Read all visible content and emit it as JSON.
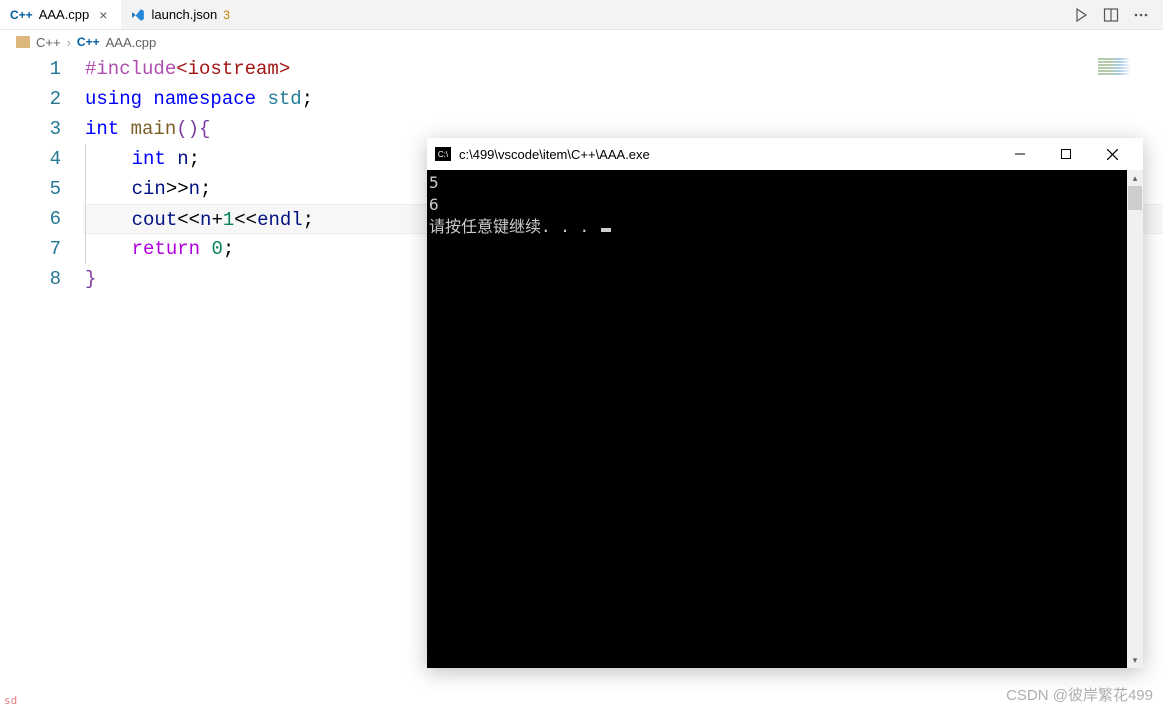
{
  "tabs": {
    "items": [
      {
        "label": "AAA.cpp",
        "icon": "C++",
        "active": true,
        "closable": true
      },
      {
        "label": "launch.json",
        "icon": "vs",
        "badge": "3",
        "active": false
      }
    ]
  },
  "breadcrumb": {
    "folder": "C++",
    "file": "AAA.cpp"
  },
  "code": {
    "lines": [
      {
        "n": "1",
        "tokens": [
          {
            "c": "tk-preproc",
            "t": "#include"
          },
          {
            "c": "tk-string",
            "t": "<iostream>"
          }
        ]
      },
      {
        "n": "2",
        "tokens": [
          {
            "c": "tk-keyword",
            "t": "using"
          },
          {
            "c": "tk-plain",
            "t": " "
          },
          {
            "c": "tk-keyword",
            "t": "namespace"
          },
          {
            "c": "tk-plain",
            "t": " "
          },
          {
            "c": "tk-namespace",
            "t": "std"
          },
          {
            "c": "tk-plain",
            "t": ";"
          }
        ]
      },
      {
        "n": "3",
        "tokens": [
          {
            "c": "tk-keyword",
            "t": "int"
          },
          {
            "c": "tk-plain",
            "t": " "
          },
          {
            "c": "tk-func",
            "t": "main"
          },
          {
            "c": "tk-brace",
            "t": "()"
          },
          {
            "c": "tk-brace",
            "t": "{"
          }
        ]
      },
      {
        "n": "4",
        "indent": 1,
        "tokens": [
          {
            "c": "tk-keyword",
            "t": "int"
          },
          {
            "c": "tk-plain",
            "t": " "
          },
          {
            "c": "tk-var",
            "t": "n"
          },
          {
            "c": "tk-plain",
            "t": ";"
          }
        ]
      },
      {
        "n": "5",
        "indent": 1,
        "tokens": [
          {
            "c": "tk-var",
            "t": "cin"
          },
          {
            "c": "tk-plain",
            "t": ">>"
          },
          {
            "c": "tk-var",
            "t": "n"
          },
          {
            "c": "tk-plain",
            "t": ";"
          }
        ]
      },
      {
        "n": "6",
        "indent": 1,
        "highlight": true,
        "tokens": [
          {
            "c": "tk-var",
            "t": "cout"
          },
          {
            "c": "tk-plain",
            "t": "<<"
          },
          {
            "c": "tk-var",
            "t": "n"
          },
          {
            "c": "tk-plain",
            "t": "+"
          },
          {
            "c": "tk-num",
            "t": "1"
          },
          {
            "c": "tk-plain",
            "t": "<<"
          },
          {
            "c": "tk-var",
            "t": "endl"
          },
          {
            "c": "tk-plain",
            "t": ";"
          }
        ]
      },
      {
        "n": "7",
        "indent": 1,
        "tokens": [
          {
            "c": "tk-control",
            "t": "return"
          },
          {
            "c": "tk-plain",
            "t": " "
          },
          {
            "c": "tk-num",
            "t": "0"
          },
          {
            "c": "tk-plain",
            "t": ";"
          }
        ]
      },
      {
        "n": "8",
        "tokens": [
          {
            "c": "tk-brace",
            "t": "}"
          }
        ]
      }
    ]
  },
  "console": {
    "title": "c:\\499\\vscode\\item\\C++\\AAA.exe",
    "output": [
      "5",
      "6",
      "请按任意键继续. . . "
    ]
  },
  "watermark": "CSDN @彼岸繁花499",
  "bottom_left": "sd"
}
